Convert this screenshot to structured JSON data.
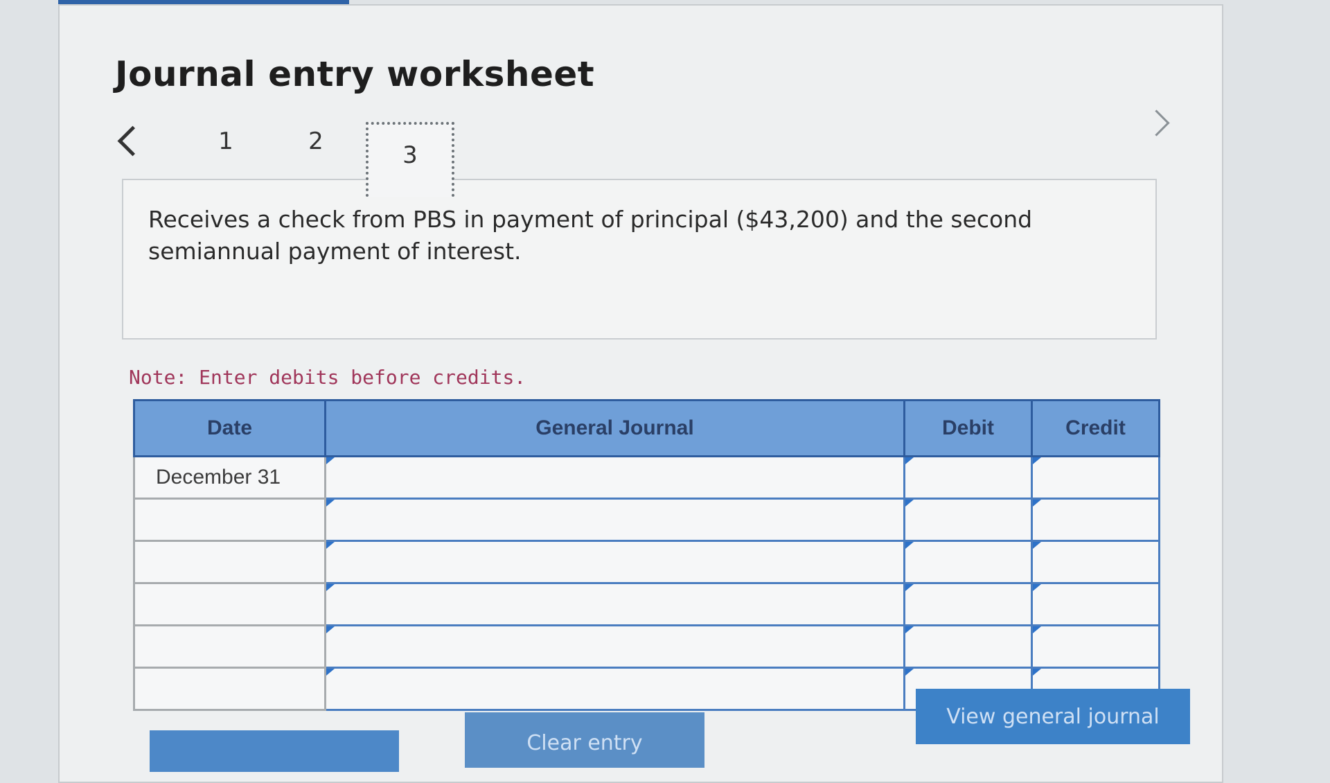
{
  "worksheet": {
    "title": "Journal entry worksheet",
    "steps": [
      "1",
      "2",
      "3"
    ],
    "active_step": "3"
  },
  "transaction": {
    "description": "Receives a check from PBS in payment of principal ($43,200) and the second semiannual payment of interest."
  },
  "note": "Note: Enter debits before credits.",
  "table": {
    "headers": {
      "date": "Date",
      "journal": "General Journal",
      "debit": "Debit",
      "credit": "Credit"
    },
    "rows": [
      {
        "date": "December 31",
        "account": "",
        "debit": "",
        "credit": ""
      },
      {
        "date": "",
        "account": "",
        "debit": "",
        "credit": ""
      },
      {
        "date": "",
        "account": "",
        "debit": "",
        "credit": ""
      },
      {
        "date": "",
        "account": "",
        "debit": "",
        "credit": ""
      },
      {
        "date": "",
        "account": "",
        "debit": "",
        "credit": ""
      },
      {
        "date": "",
        "account": "",
        "debit": "",
        "credit": ""
      }
    ]
  },
  "buttons": {
    "view_general_journal": "View general journal",
    "clear_entry": "Clear entry",
    "record_entry": ""
  },
  "colors": {
    "header_fill": "#6f9fd8",
    "grid_lines": "#4a7dc0",
    "button": "#3d82c8",
    "note_text": "#a0365a"
  },
  "icons": {
    "prev": "chevron-left-icon",
    "next": "chevron-right-icon",
    "cell_marker": "triangle-marker-icon"
  }
}
